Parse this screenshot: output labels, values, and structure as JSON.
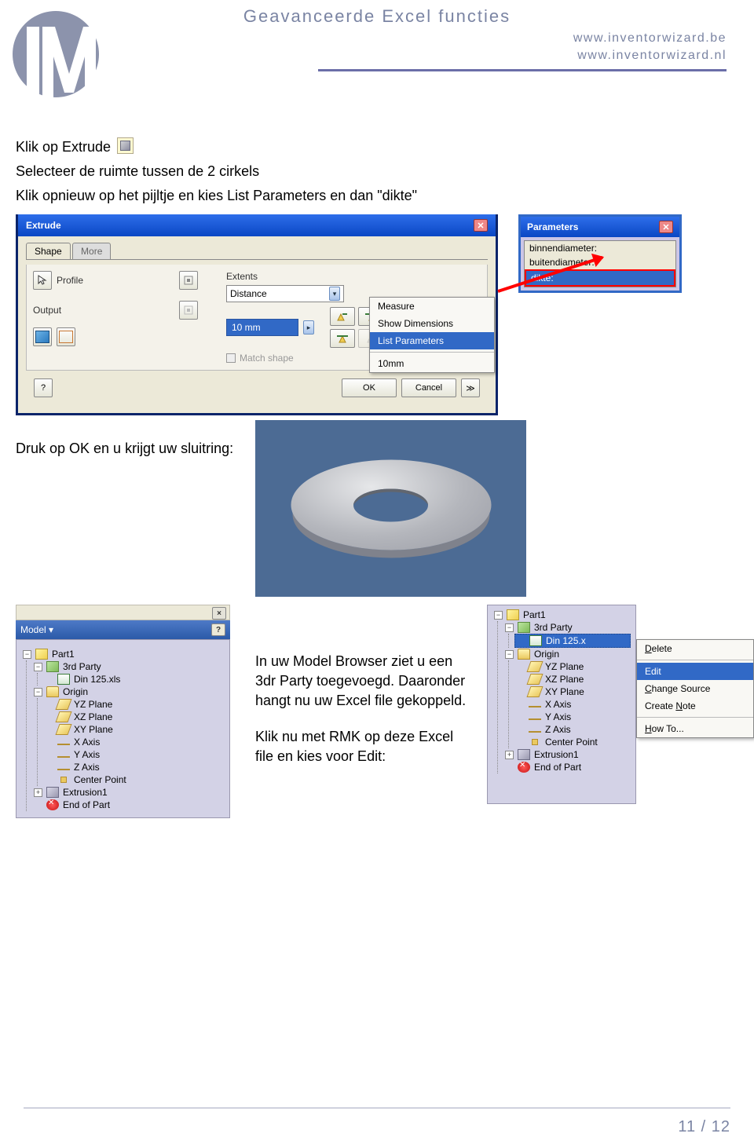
{
  "header": {
    "title": "Geavanceerde Excel functies",
    "url1": "www.inventorwizard.be",
    "url2": "www.inventorwizard.nl"
  },
  "intro": {
    "line1_pre": "Klik op Extrude",
    "line2": "Selecteer de ruimte tussen de 2 cirkels",
    "line3": "Klik opnieuw op het pijltje en kies List Parameters en dan \"dikte\""
  },
  "extrudeDlg": {
    "title": "Extrude",
    "tab1": "Shape",
    "tab2": "More",
    "profile": "Profile",
    "output": "Output",
    "extents": "Extents",
    "extentsMode": "Distance",
    "distance": "10 mm",
    "matchShape": "Match shape",
    "ok": "OK",
    "cancel": "Cancel"
  },
  "ctxMenu": {
    "measure": "Measure",
    "showDim": "Show Dimensions",
    "listParams": "List Parameters",
    "tenmm": "10mm"
  },
  "paramPopup": {
    "title": "Parameters",
    "p1": "binnendiameter:",
    "p2": "buitendiameter:",
    "p3": "dikte:"
  },
  "mid": {
    "druk": "Druk op OK en u krijgt uw sluitring:"
  },
  "browser": {
    "header": "Model",
    "part": "Part1",
    "thirdParty": "3rd Party",
    "xls": "Din 125.xls",
    "origin": "Origin",
    "yz": "YZ Plane",
    "xz": "XZ Plane",
    "xy": "XY Plane",
    "xaxis": "X Axis",
    "yaxis": "Y Axis",
    "zaxis": "Z Axis",
    "center": "Center Point",
    "extr": "Extrusion1",
    "end": "End of Part"
  },
  "browser2Sel": "Din 125.x",
  "midtext": {
    "p1": "In uw Model Browser ziet u een 3dr Party toegevoegd. Daaronder hangt nu uw Excel file gekoppeld.",
    "p2": "Klik nu met RMK op deze Excel file en kies voor Edit:"
  },
  "ctx2": {
    "delete": "Delete",
    "edit": "Edit",
    "changeSrc": "Change Source",
    "createNote": "Create Note",
    "howto": "How To..."
  },
  "footer": "11 / 12"
}
